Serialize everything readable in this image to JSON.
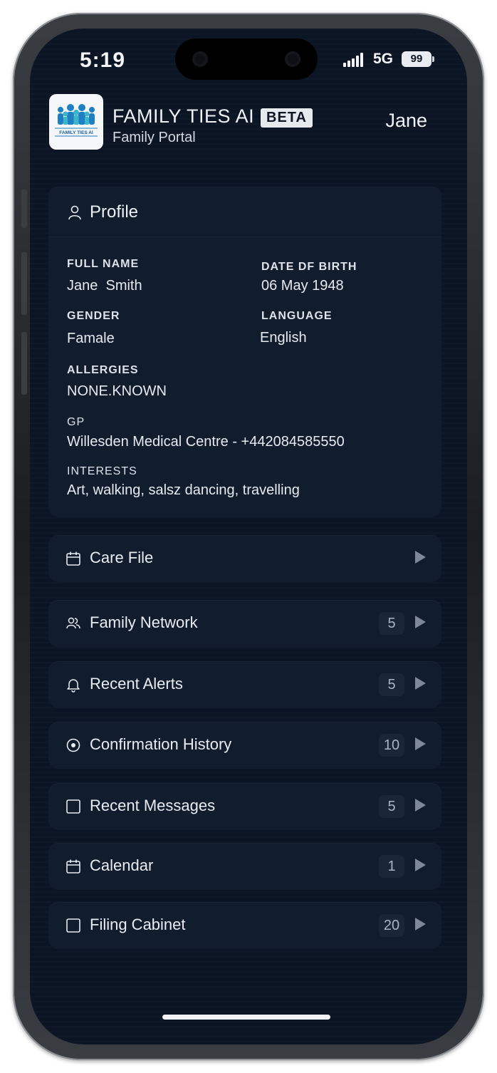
{
  "status_bar": {
    "time": "5:19",
    "network": "5G",
    "battery": "99"
  },
  "header": {
    "logo_text": "FAMILY TIES AI",
    "app_title": "FAMILY TIES AI",
    "beta_badge": "BETA",
    "subtitle": "Family Portal",
    "user_name": "Jane"
  },
  "profile": {
    "title": "Profile",
    "full_name_label": "FULL NAME",
    "full_name": "Jane  Smith",
    "dob_label": "DATE DF BIRTH",
    "dob": "06 May 1948",
    "gender_label": "GENDER",
    "gender": "Famale",
    "language_label": "LANGUAGE",
    "language": "English",
    "allergies_label": "ALLERGIES",
    "allergies": "NONE.KNOWN",
    "gp_label": "GP",
    "gp": "Willesden Medical Centre - +442084585550",
    "interests_label": "INTERESTS",
    "interests": "Art, walking, salsz dancing, travelling"
  },
  "menu": {
    "care_file": {
      "label": "Care File",
      "icon": "clipboard-icon"
    },
    "family_network": {
      "label": "Family Network",
      "count": "5",
      "icon": "people-icon"
    },
    "recent_alerts": {
      "label": "Recent Alerts",
      "count": "5",
      "icon": "bell-icon"
    },
    "confirmation_history": {
      "label": "Confirmation History",
      "count": "10",
      "icon": "target-icon"
    },
    "recent_messages": {
      "label": "Recent Messages",
      "count": "5",
      "icon": "square-icon"
    },
    "calendar": {
      "label": "Calendar",
      "count": "1",
      "icon": "calendar-icon"
    },
    "filing_cabinet": {
      "label": "Filing Cabinet",
      "count": "20",
      "icon": "square-icon"
    }
  },
  "colors": {
    "background": "#0c1524",
    "card": "#111c2d",
    "badge": "#1a2538",
    "text": "#e8ecf3"
  }
}
